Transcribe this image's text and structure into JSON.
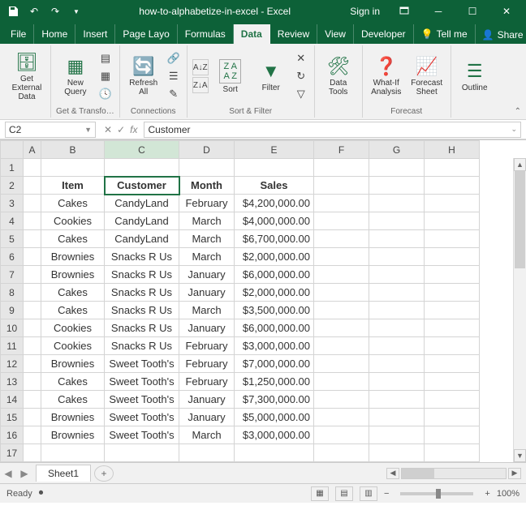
{
  "titlebar": {
    "filename": "how-to-alphabetize-in-excel - Excel",
    "signin": "Sign in"
  },
  "menutabs": [
    "File",
    "Home",
    "Insert",
    "Page Layo",
    "Formulas",
    "Data",
    "Review",
    "View",
    "Developer"
  ],
  "activeTab": "Data",
  "tellme": "Tell me",
  "share": "Share",
  "ribbon": {
    "getExternal": "Get External Data",
    "newQuery": "New Query",
    "getTransform": "Get & Transfo…",
    "refreshAll": "Refresh All",
    "connections": "Connections",
    "sort": "Sort",
    "sortFilter": "Sort & Filter",
    "filter": "Filter",
    "dataTools": "Data Tools",
    "whatIf": "What-If Analysis",
    "forecastSheet": "Forecast Sheet",
    "forecast": "Forecast",
    "outline": "Outline"
  },
  "namebox": "C2",
  "formula": "Customer",
  "columns": [
    "A",
    "B",
    "C",
    "D",
    "E",
    "F",
    "G",
    "H"
  ],
  "headers": {
    "item": "Item",
    "customer": "Customer",
    "month": "Month",
    "sales": "Sales"
  },
  "rows": [
    {
      "n": 3,
      "item": "Cakes",
      "customer": "CandyLand",
      "month": "February",
      "sales": "$4,200,000.00"
    },
    {
      "n": 4,
      "item": "Cookies",
      "customer": "CandyLand",
      "month": "March",
      "sales": "$4,000,000.00"
    },
    {
      "n": 5,
      "item": "Cakes",
      "customer": "CandyLand",
      "month": "March",
      "sales": "$6,700,000.00"
    },
    {
      "n": 6,
      "item": "Brownies",
      "customer": "Snacks R Us",
      "month": "March",
      "sales": "$2,000,000.00"
    },
    {
      "n": 7,
      "item": "Brownies",
      "customer": "Snacks R Us",
      "month": "January",
      "sales": "$6,000,000.00"
    },
    {
      "n": 8,
      "item": "Cakes",
      "customer": "Snacks R Us",
      "month": "January",
      "sales": "$2,000,000.00"
    },
    {
      "n": 9,
      "item": "Cakes",
      "customer": "Snacks R Us",
      "month": "March",
      "sales": "$3,500,000.00"
    },
    {
      "n": 10,
      "item": "Cookies",
      "customer": "Snacks R Us",
      "month": "January",
      "sales": "$6,000,000.00"
    },
    {
      "n": 11,
      "item": "Cookies",
      "customer": "Snacks R Us",
      "month": "February",
      "sales": "$3,000,000.00"
    },
    {
      "n": 12,
      "item": "Brownies",
      "customer": "Sweet Tooth's",
      "month": "February",
      "sales": "$7,000,000.00"
    },
    {
      "n": 13,
      "item": "Cakes",
      "customer": "Sweet Tooth's",
      "month": "February",
      "sales": "$1,250,000.00"
    },
    {
      "n": 14,
      "item": "Cakes",
      "customer": "Sweet Tooth's",
      "month": "January",
      "sales": "$7,300,000.00"
    },
    {
      "n": 15,
      "item": "Brownies",
      "customer": "Sweet Tooth's",
      "month": "January",
      "sales": "$5,000,000.00"
    },
    {
      "n": 16,
      "item": "Brownies",
      "customer": "Sweet Tooth's",
      "month": "March",
      "sales": "$3,000,000.00"
    }
  ],
  "sheet": "Sheet1",
  "status": "Ready",
  "zoom": "100%"
}
